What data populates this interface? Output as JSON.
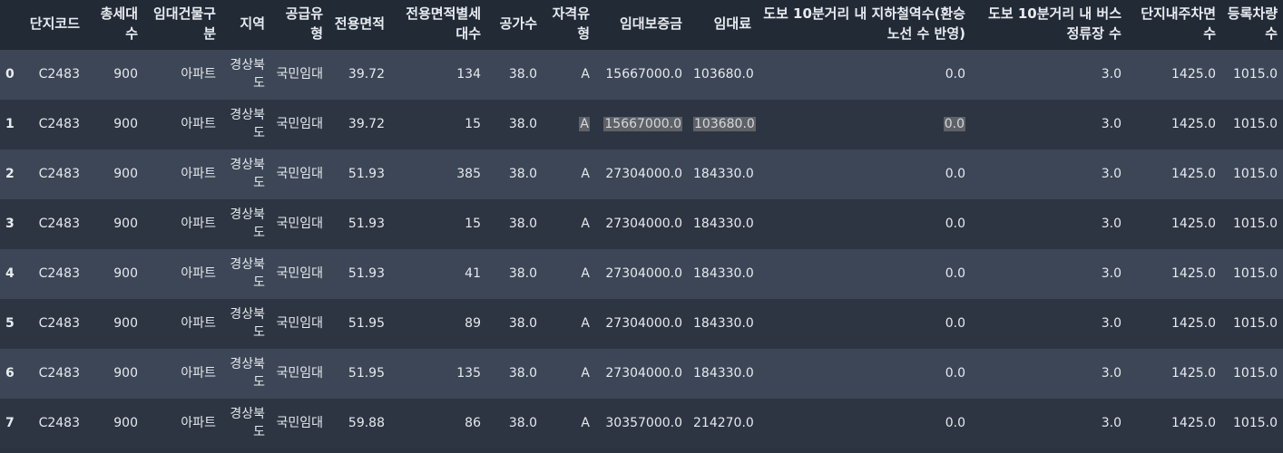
{
  "table": {
    "columns": [
      "",
      "단지코드",
      "총세대수",
      "임대건물구분",
      "지역",
      "공급유형",
      "전용면적",
      "전용면적별세대수",
      "공가수",
      "자격유형",
      "임대보증금",
      "임대료",
      "도보 10분거리 내 지하철역수(환승노선 수 반영)",
      "도보 10분거리 내 버스정류장 수",
      "단지내주차면수",
      "등록차량수"
    ],
    "rows": [
      {
        "idx": "0",
        "code": "C2483",
        "households": "900",
        "building": "아파트",
        "region": "경상북도",
        "supply": "국민임대",
        "area": "39.72",
        "area_households": "134",
        "vacant": "38.0",
        "qual": "A",
        "deposit": "15667000.0",
        "rent": "103680.0",
        "subway": "0.0",
        "bus": "3.0",
        "parking": "1425.0",
        "cars": "1015.0"
      },
      {
        "idx": "1",
        "code": "C2483",
        "households": "900",
        "building": "아파트",
        "region": "경상북도",
        "supply": "국민임대",
        "area": "39.72",
        "area_households": "15",
        "vacant": "38.0",
        "qual": "A",
        "deposit": "15667000.0",
        "rent": "103680.0",
        "subway": "0.0",
        "bus": "3.0",
        "parking": "1425.0",
        "cars": "1015.0"
      },
      {
        "idx": "2",
        "code": "C2483",
        "households": "900",
        "building": "아파트",
        "region": "경상북도",
        "supply": "국민임대",
        "area": "51.93",
        "area_households": "385",
        "vacant": "38.0",
        "qual": "A",
        "deposit": "27304000.0",
        "rent": "184330.0",
        "subway": "0.0",
        "bus": "3.0",
        "parking": "1425.0",
        "cars": "1015.0"
      },
      {
        "idx": "3",
        "code": "C2483",
        "households": "900",
        "building": "아파트",
        "region": "경상북도",
        "supply": "국민임대",
        "area": "51.93",
        "area_households": "15",
        "vacant": "38.0",
        "qual": "A",
        "deposit": "27304000.0",
        "rent": "184330.0",
        "subway": "0.0",
        "bus": "3.0",
        "parking": "1425.0",
        "cars": "1015.0"
      },
      {
        "idx": "4",
        "code": "C2483",
        "households": "900",
        "building": "아파트",
        "region": "경상북도",
        "supply": "국민임대",
        "area": "51.93",
        "area_households": "41",
        "vacant": "38.0",
        "qual": "A",
        "deposit": "27304000.0",
        "rent": "184330.0",
        "subway": "0.0",
        "bus": "3.0",
        "parking": "1425.0",
        "cars": "1015.0"
      },
      {
        "idx": "5",
        "code": "C2483",
        "households": "900",
        "building": "아파트",
        "region": "경상북도",
        "supply": "국민임대",
        "area": "51.95",
        "area_households": "89",
        "vacant": "38.0",
        "qual": "A",
        "deposit": "27304000.0",
        "rent": "184330.0",
        "subway": "0.0",
        "bus": "3.0",
        "parking": "1425.0",
        "cars": "1015.0"
      },
      {
        "idx": "6",
        "code": "C2483",
        "households": "900",
        "building": "아파트",
        "region": "경상북도",
        "supply": "국민임대",
        "area": "51.95",
        "area_households": "135",
        "vacant": "38.0",
        "qual": "A",
        "deposit": "27304000.0",
        "rent": "184330.0",
        "subway": "0.0",
        "bus": "3.0",
        "parking": "1425.0",
        "cars": "1015.0"
      },
      {
        "idx": "7",
        "code": "C2483",
        "households": "900",
        "building": "아파트",
        "region": "경상북도",
        "supply": "국민임대",
        "area": "59.88",
        "area_households": "86",
        "vacant": "38.0",
        "qual": "A",
        "deposit": "30357000.0",
        "rent": "214270.0",
        "subway": "0.0",
        "bus": "3.0",
        "parking": "1425.0",
        "cars": "1015.0"
      }
    ],
    "selected_row": "1",
    "selected_columns": [
      "qual",
      "deposit",
      "rent",
      "subway"
    ]
  },
  "colors": {
    "header_bg": "#222a36",
    "row_odd": "#3c4656",
    "row_even": "#2d3542",
    "selection": "#5e6267"
  }
}
